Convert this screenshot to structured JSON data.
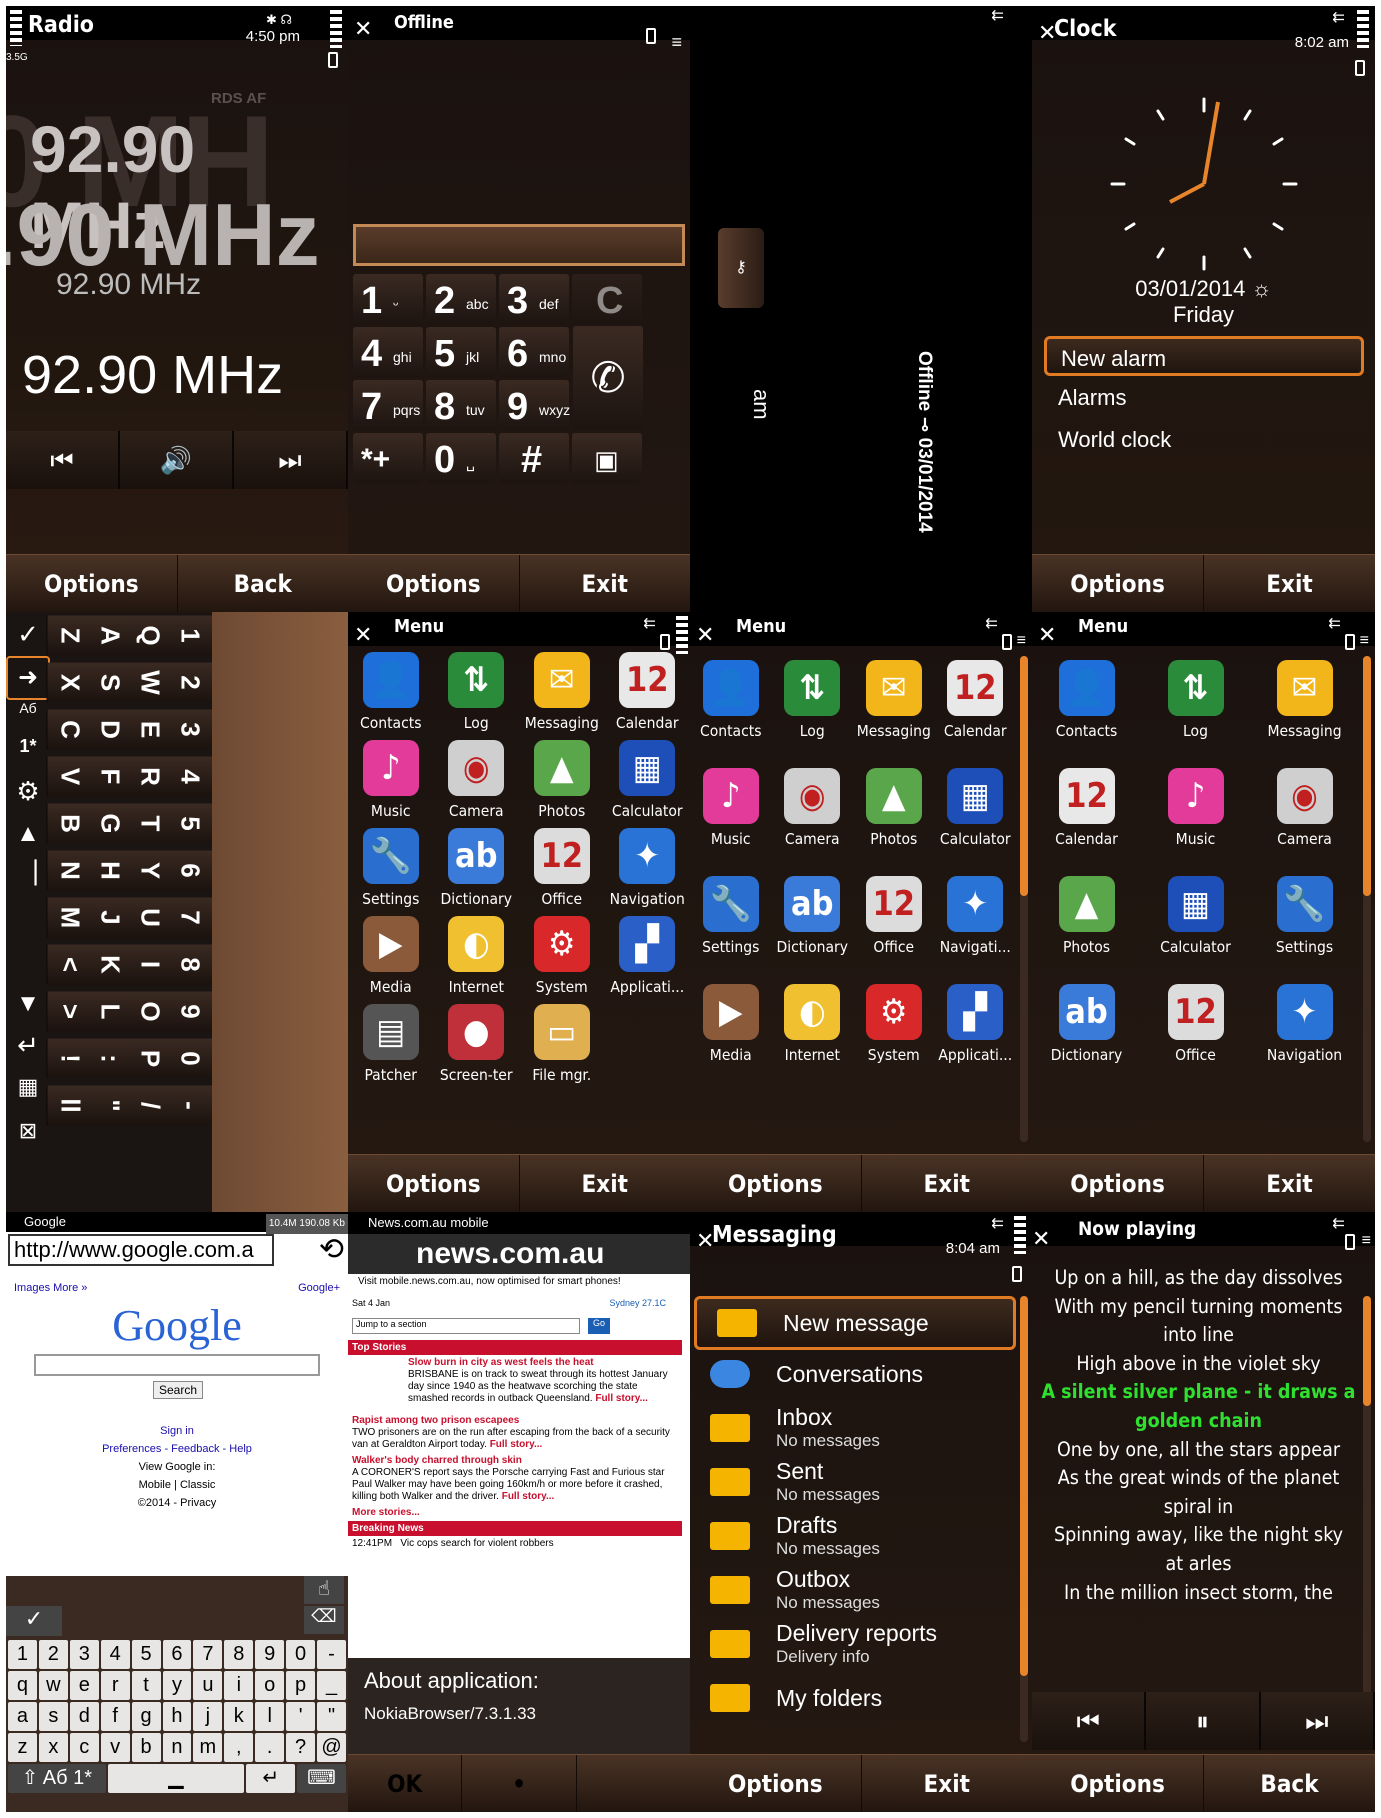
{
  "radio": {
    "title": "Radio",
    "time": "4:50 pm",
    "net": "3.5G",
    "rds": "RDS  AF",
    "ghost": "0 MH",
    "freq_big1": "92.90 MHz",
    "freq_big2": ".90 MHz",
    "freq_mid": "92.90 MHz",
    "freq_main": "92.90 MHz",
    "controls": [
      "⏮",
      "🔊",
      "⏭"
    ],
    "softkeys": [
      "Options",
      "Back"
    ]
  },
  "dialer": {
    "title": "Offline",
    "keys": [
      {
        "n": "1",
        "l": "ᵕ"
      },
      {
        "n": "2",
        "l": "abc"
      },
      {
        "n": "3",
        "l": "def"
      },
      {
        "n": "C",
        "l": ""
      },
      {
        "n": "4",
        "l": "ghi"
      },
      {
        "n": "5",
        "l": "jkl"
      },
      {
        "n": "6",
        "l": "mno"
      },
      {
        "n": "",
        "l": ""
      },
      {
        "n": "7",
        "l": "pqrs"
      },
      {
        "n": "8",
        "l": "tuv"
      },
      {
        "n": "9",
        "l": "wxyz"
      },
      {
        "n": "",
        "l": ""
      },
      {
        "n": "*+",
        "l": ""
      },
      {
        "n": "0",
        "l": "␣"
      },
      {
        "n": "#",
        "l": ""
      },
      {
        "n": "▣",
        "l": ""
      }
    ],
    "softkeys": [
      "Options",
      "Exit"
    ]
  },
  "lockscreen": {
    "time": "8:01",
    "ampm": "am",
    "status": "Offline ⊸ 03/01/2014"
  },
  "clock": {
    "title": "Clock",
    "time": "8:02 am",
    "date": "03/01/2014 ☼",
    "day": "Friday",
    "items": [
      "New alarm",
      "Alarms",
      "World clock"
    ],
    "softkeys": [
      "Options",
      "Exit"
    ]
  },
  "qwerty": {
    "cols": [
      [
        "1",
        "2",
        "3",
        "4",
        "5",
        "6",
        "7",
        "8",
        "9",
        "0",
        "-"
      ],
      [
        "Q",
        "W",
        "E",
        "R",
        "T",
        "Y",
        "U",
        "I",
        "O",
        "P",
        "/"
      ],
      [
        "A",
        "S",
        "D",
        "F",
        "G",
        "H",
        "J",
        "K",
        "L",
        ":",
        "\""
      ],
      [
        "Z",
        "X",
        "C",
        "V",
        "B",
        "N",
        "M",
        "<",
        ">",
        "!",
        "ll"
      ]
    ]
  },
  "menu1": {
    "title": "Menu",
    "items": [
      {
        "label": "Contacts",
        "icon": "contacts-icon"
      },
      {
        "label": "Log",
        "icon": "log-icon"
      },
      {
        "label": "Messaging",
        "icon": "messaging-icon"
      },
      {
        "label": "Calendar",
        "icon": "calendar-icon"
      },
      {
        "label": "Music",
        "icon": "music-icon"
      },
      {
        "label": "Camera",
        "icon": "camera-icon"
      },
      {
        "label": "Photos",
        "icon": "photos-icon"
      },
      {
        "label": "Calculator",
        "icon": "calculator-icon"
      },
      {
        "label": "Settings",
        "icon": "settings-icon"
      },
      {
        "label": "Dictionary",
        "icon": "dictionary-icon"
      },
      {
        "label": "Office",
        "icon": "office-icon"
      },
      {
        "label": "Navigation",
        "icon": "navigation-icon"
      },
      {
        "label": "Media",
        "icon": "media-icon"
      },
      {
        "label": "Internet",
        "icon": "internet-icon"
      },
      {
        "label": "System",
        "icon": "system-icon"
      },
      {
        "label": "Applicati...",
        "icon": "applications-icon"
      },
      {
        "label": "Patcher",
        "icon": "patcher-icon"
      },
      {
        "label": "Screen-ter",
        "icon": "screen-recorder-icon"
      },
      {
        "label": "File mgr.",
        "icon": "file-manager-icon"
      }
    ],
    "softkeys": [
      "Options",
      "Exit"
    ]
  },
  "menu2": {
    "title": "Menu",
    "items": [
      {
        "label": "Contacts",
        "icon": "contacts-icon"
      },
      {
        "label": "Log",
        "icon": "log-icon"
      },
      {
        "label": "Messaging",
        "icon": "messaging-icon"
      },
      {
        "label": "Calendar",
        "icon": "calendar-icon"
      },
      {
        "label": "Music",
        "icon": "music-icon"
      },
      {
        "label": "Camera",
        "icon": "camera-icon"
      },
      {
        "label": "Photos",
        "icon": "photos-icon"
      },
      {
        "label": "Calculator",
        "icon": "calculator-icon"
      },
      {
        "label": "Settings",
        "icon": "settings-icon"
      },
      {
        "label": "Dictionary",
        "icon": "dictionary-icon"
      },
      {
        "label": "Office",
        "icon": "office-icon"
      },
      {
        "label": "Navigati...",
        "icon": "navigation-icon"
      },
      {
        "label": "Media",
        "icon": "media-icon"
      },
      {
        "label": "Internet",
        "icon": "internet-icon"
      },
      {
        "label": "System",
        "icon": "system-icon"
      },
      {
        "label": "Applicati...",
        "icon": "applications-icon"
      }
    ],
    "softkeys": [
      "Options",
      "Exit"
    ]
  },
  "menu3": {
    "title": "Menu",
    "items": [
      {
        "label": "Contacts",
        "icon": "contacts-icon"
      },
      {
        "label": "Log",
        "icon": "log-icon"
      },
      {
        "label": "Messaging",
        "icon": "messaging-icon"
      },
      {
        "label": "Calendar",
        "icon": "calendar-icon"
      },
      {
        "label": "Music",
        "icon": "music-icon"
      },
      {
        "label": "Camera",
        "icon": "camera-icon"
      },
      {
        "label": "Photos",
        "icon": "photos-icon"
      },
      {
        "label": "Calculator",
        "icon": "calculator-icon"
      },
      {
        "label": "Settings",
        "icon": "settings-icon"
      },
      {
        "label": "Dictionary",
        "icon": "dictionary-icon"
      },
      {
        "label": "Office",
        "icon": "office-icon"
      },
      {
        "label": "Navigation",
        "icon": "navigation-icon"
      }
    ],
    "softkeys": [
      "Options",
      "Exit"
    ]
  },
  "google": {
    "title": "Google",
    "mem": "10.4M 190.08 Kb",
    "url": "http://www.google.com.a",
    "links_top": [
      "Images",
      "More »"
    ],
    "plus": "Google+",
    "logo": "Google",
    "search_btn": "Search",
    "signin": "Sign in",
    "prefs": "Preferences - Feedback - Help",
    "view": "View Google in:",
    "modes": "Mobile | Classic",
    "copy": "©2014 - Privacy",
    "kb_rows": [
      [
        "1",
        "2",
        "3",
        "4",
        "5",
        "6",
        "7",
        "8",
        "9",
        "0",
        "-"
      ],
      [
        "q",
        "w",
        "e",
        "r",
        "t",
        "y",
        "u",
        "i",
        "o",
        "p",
        "_"
      ],
      [
        "a",
        "s",
        "d",
        "f",
        "g",
        "h",
        "j",
        "k",
        "l",
        "'",
        "\""
      ],
      [
        "z",
        "x",
        "c",
        "v",
        "b",
        "n",
        "m",
        ",",
        ".",
        "?",
        "@"
      ]
    ]
  },
  "news": {
    "title": "News.com.au mobile",
    "logo": "news.com.au",
    "promo": "Visit mobile.news.com.au, now optimised for smart phones!",
    "date": "Sat 4 Jan",
    "weather": "Sydney 27.1C",
    "jump": "Jump to a section",
    "go": "Go",
    "top": "Top Stories",
    "story1_h": "Slow burn in city as west feels the heat",
    "story1": "BRISBANE is on track to sweat through its hottest January day since 1940 as the heatwave scorching the state smashed records in outback Queensland.",
    "story2_h": "Rapist among two prison escapees",
    "story2": "TWO prisoners are on the run after escaping from the back of a security van at Geraldton Airport today.",
    "story3_h": "Walker's body charred through skin",
    "story3": "A CORONER'S report says the Porsche carrying Fast and Furious star Paul Walker may have been going 160km/h or more before it crashed, killing both Walker and the driver.",
    "full": "Full story...",
    "more": "More stories...",
    "breaking": "Breaking News",
    "b1_time": "12:41PM",
    "b1": "Vic cops search for violent robbers",
    "about_title": "About application:",
    "about_ver": "NokiaBrowser/7.3.1.33",
    "softkeys": [
      "OK",
      "•",
      ""
    ]
  },
  "messaging": {
    "title": "Messaging",
    "time": "8:04 am",
    "rows": [
      {
        "a": "New message",
        "b": ""
      },
      {
        "a": "Conversations",
        "b": ""
      },
      {
        "a": "Inbox",
        "b": "No messages"
      },
      {
        "a": "Sent",
        "b": "No messages"
      },
      {
        "a": "Drafts",
        "b": "No messages"
      },
      {
        "a": "Outbox",
        "b": "No messages"
      },
      {
        "a": "Delivery reports",
        "b": "Delivery info"
      },
      {
        "a": "My folders",
        "b": ""
      }
    ],
    "softkeys": [
      "Options",
      "Exit"
    ]
  },
  "nowplaying": {
    "title": "Now playing",
    "lyrics": [
      "Up on a hill, as the day dissolves",
      "With my pencil turning moments",
      "into line",
      "High above in the violet sky",
      "A silent silver plane - it draws a",
      "golden chain",
      "One by one, all the stars appear",
      "As the great winds of the planet",
      "spiral in",
      "Spinning away, like the night sky",
      "at arles",
      "In the million insect storm, the"
    ],
    "controls": [
      "⏮",
      "⏸",
      "⏭"
    ],
    "softkeys": [
      "Options",
      "Back"
    ]
  }
}
